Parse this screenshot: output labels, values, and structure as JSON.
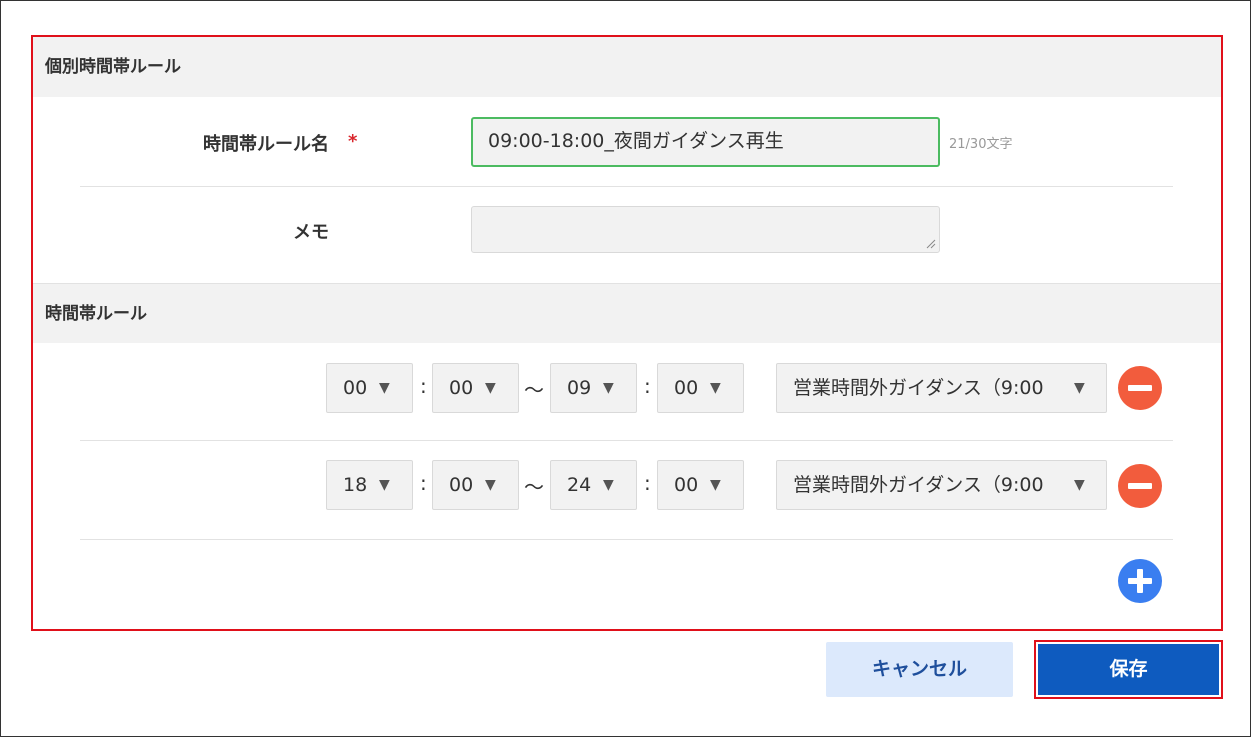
{
  "sections": {
    "individual_title": "個別時間帯ルール",
    "rules_title": "時間帯ルール"
  },
  "form": {
    "name_label": "時間帯ルール名",
    "required_mark": "*",
    "name_value": "09:00-18:00_夜間ガイダンス再生",
    "char_count": "21/30文字",
    "memo_label": "メモ",
    "memo_value": ""
  },
  "rules": [
    {
      "start_hour": "00",
      "start_min": "00",
      "end_hour": "09",
      "end_min": "00",
      "guidance": "営業時間外ガイダンス（9:00"
    },
    {
      "start_hour": "18",
      "start_min": "00",
      "end_hour": "24",
      "end_min": "00",
      "guidance": "営業時間外ガイダンス（9:00"
    }
  ],
  "separators": {
    "colon": ":",
    "tilde": "～",
    "caret": "▼"
  },
  "buttons": {
    "cancel": "キャンセル",
    "save": "保存"
  },
  "icons": {
    "remove": "minus-circle-icon",
    "add": "plus-circle-icon"
  },
  "colors": {
    "highlight_border": "#e0101a",
    "active_input_border": "#4cbb61",
    "remove_button": "#f25c3d",
    "add_button": "#3a7ef0",
    "save_button": "#0e5bbf",
    "cancel_button_bg": "#dce9fc"
  }
}
